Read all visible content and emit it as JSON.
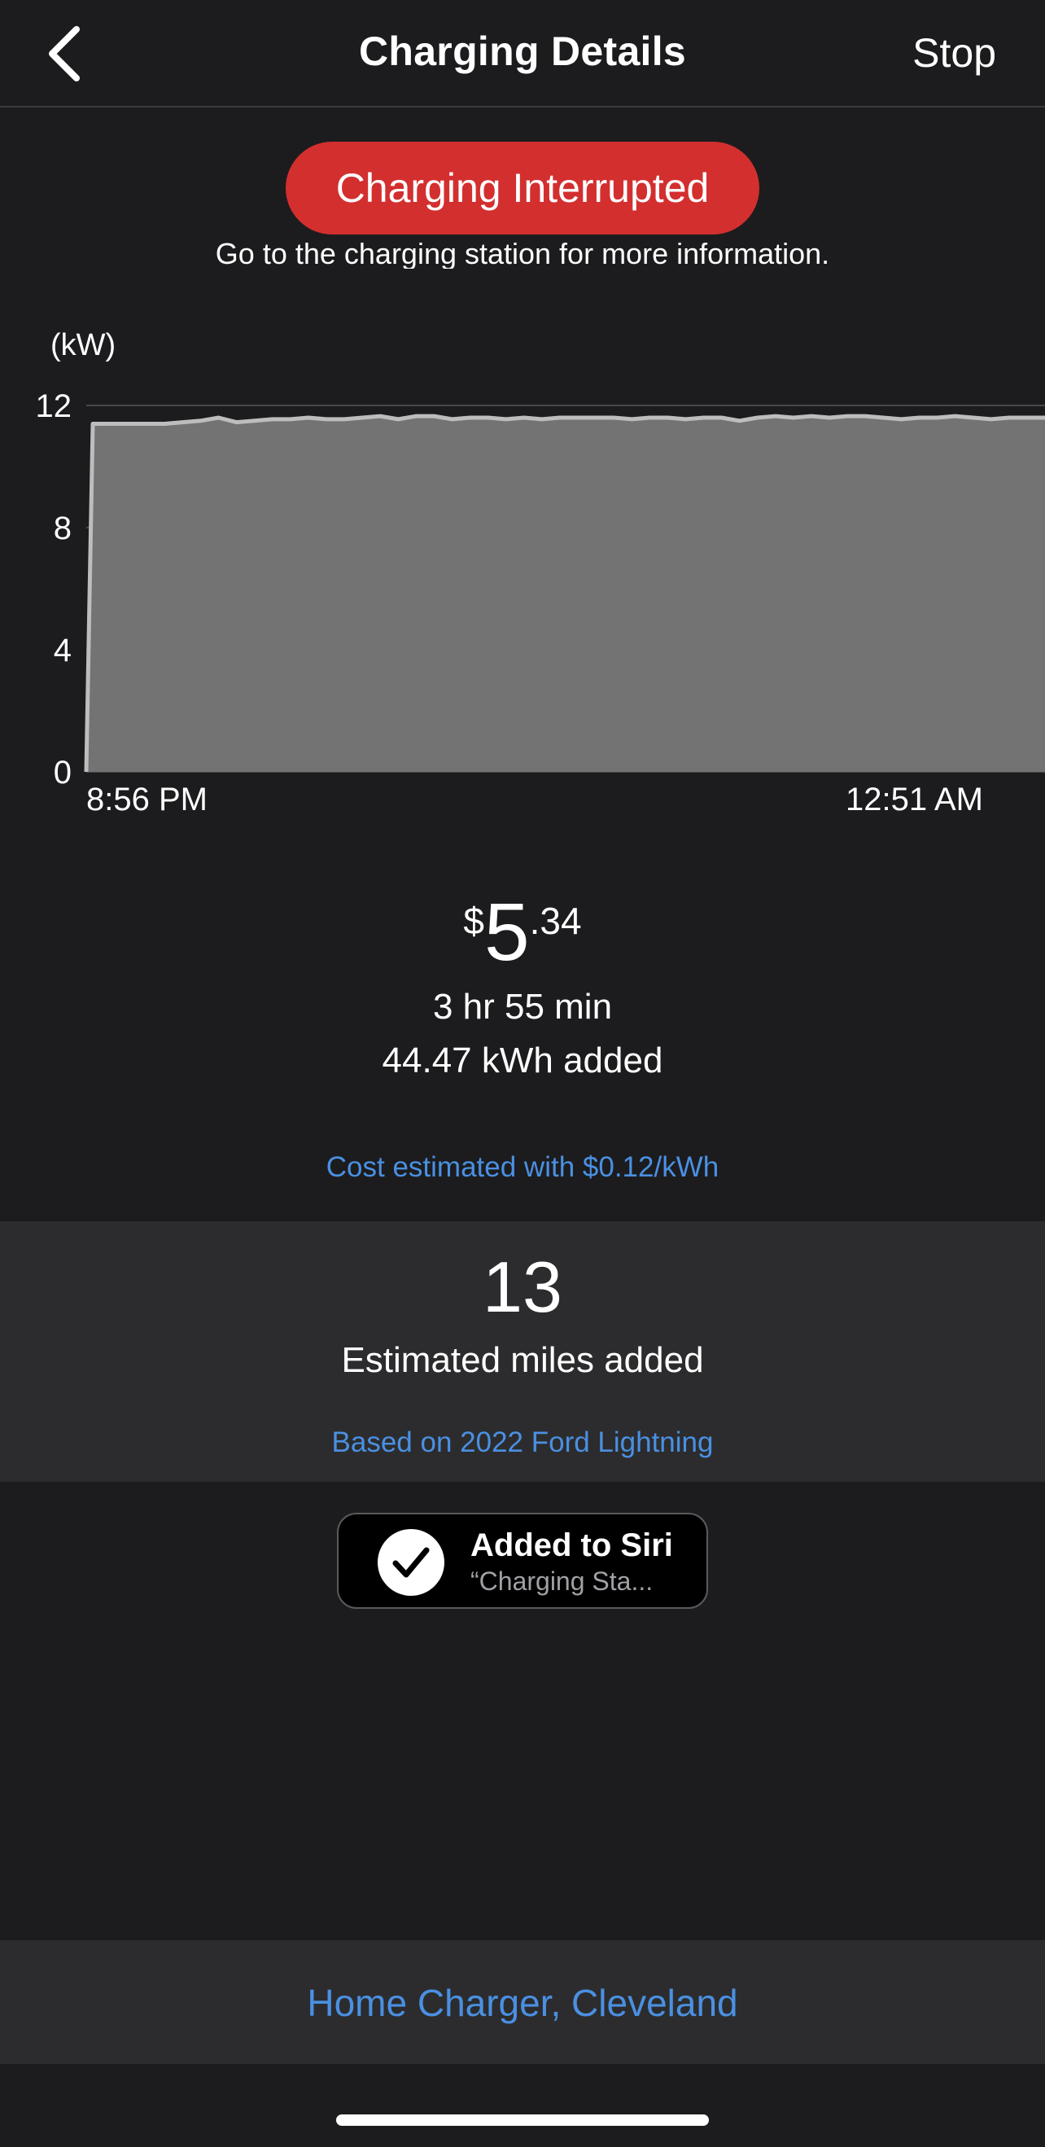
{
  "navbar": {
    "title": "Charging Details",
    "stop_label": "Stop"
  },
  "status": {
    "badge": "Charging Interrupted",
    "message": "Go to the charging station for more information.",
    "badge_color": "#d32f2f"
  },
  "chart_data": {
    "type": "area",
    "ylabel": "(kW)",
    "yticks": [
      "12",
      "8",
      "4",
      "0"
    ],
    "ylim": [
      0,
      12
    ],
    "x_start_label": "8:56 PM",
    "x_end_label": "12:51 AM",
    "grid": true,
    "values": [
      0,
      11.4,
      11.4,
      11.4,
      11.4,
      11.4,
      11.45,
      11.5,
      11.6,
      11.45,
      11.5,
      11.55,
      11.55,
      11.6,
      11.55,
      11.55,
      11.6,
      11.65,
      11.55,
      11.65,
      11.65,
      11.55,
      11.6,
      11.6,
      11.55,
      11.6,
      11.55,
      11.6,
      11.6,
      11.6,
      11.6,
      11.55,
      11.6,
      11.6,
      11.55,
      11.6,
      11.6,
      11.5,
      11.6,
      11.65,
      11.6,
      11.65,
      11.6,
      11.65,
      11.65,
      11.6,
      11.55,
      11.6,
      11.6,
      11.65,
      11.6,
      11.55,
      11.6,
      11.6,
      11.6
    ],
    "fill_color": "#737373",
    "line_color": "#bdbdbd"
  },
  "summary": {
    "currency": "$",
    "cost_whole": "5",
    "cost_cents": ".34",
    "duration": "3 hr 55 min",
    "energy": "44.47 kWh added",
    "cost_note": "Cost estimated with $0.12/kWh"
  },
  "miles": {
    "value": "13",
    "label": "Estimated miles added",
    "note": "Based on 2022 Ford Lightning"
  },
  "siri": {
    "title": "Added to Siri",
    "subtitle": "“Charging Sta..."
  },
  "location": {
    "name": "Home Charger, Cleveland"
  },
  "colors": {
    "background": "#1c1c1e",
    "panel": "#2c2c2e",
    "link": "#4a90e2"
  }
}
